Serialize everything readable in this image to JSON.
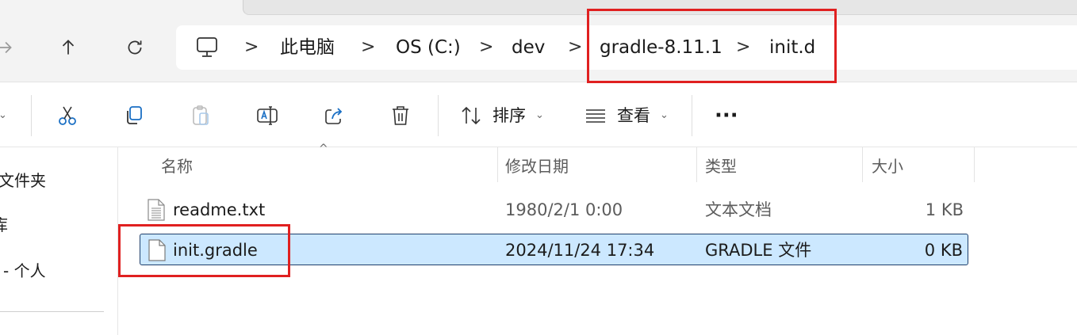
{
  "navigation": {
    "forward_icon": "arrow-right-icon",
    "up_icon": "arrow-up-icon",
    "refresh_icon": "refresh-icon"
  },
  "address_bar": {
    "root_icon": "computer-icon",
    "crumbs": [
      "此电脑",
      "OS (C:)",
      "dev",
      "gradle-8.11.1",
      "init.d"
    ],
    "separator": ">"
  },
  "toolbar": {
    "cut_icon": "scissors-icon",
    "copy_icon": "copy-icon",
    "paste_icon": "paste-icon",
    "rename_icon": "rename-icon",
    "share_icon": "share-icon",
    "delete_icon": "trash-icon",
    "sort_label": "排序",
    "view_label": "查看",
    "more_label": "···",
    "caret": "⌄"
  },
  "sidebar": {
    "items": [
      "文件夹",
      "库",
      "- 个人"
    ]
  },
  "file_list": {
    "columns": [
      "名称",
      "修改日期",
      "类型",
      "大小"
    ],
    "sort_indicator": "^",
    "rows": [
      {
        "name": "readme.txt",
        "modified": "1980/2/1 0:00",
        "type": "文本文档",
        "size": "1 KB",
        "selected": false
      },
      {
        "name": "init.gradle",
        "modified": "2024/11/24 17:34",
        "type": "GRADLE 文件",
        "size": "0 KB",
        "selected": true
      }
    ]
  },
  "colors": {
    "highlight": "#e02020",
    "selection": "#cce8ff"
  }
}
